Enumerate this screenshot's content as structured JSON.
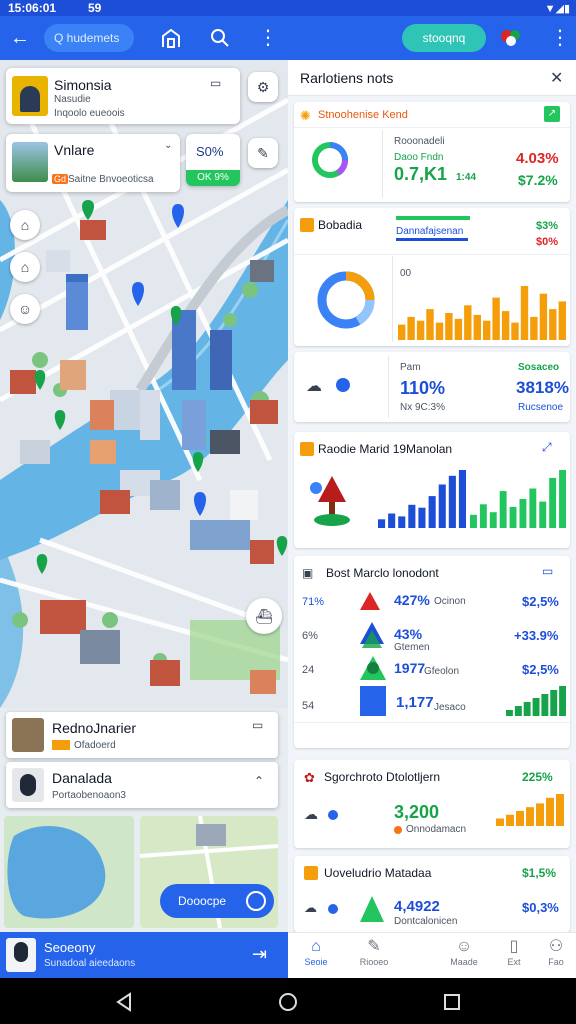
{
  "status": {
    "time": "15:06:01",
    "extra": "59",
    "signal": "▼◢▮"
  },
  "left_appbar": {
    "search_label": "Q hudemets"
  },
  "right_appbar": {
    "pill_label": "stooqnq"
  },
  "map_cards": {
    "top": {
      "title": "Simonsia",
      "subtitle": "Nasudie",
      "line3": "Inqoolo eueoois"
    },
    "second": {
      "title": "Vnlare",
      "badge": "Gd",
      "subtitle": "Saitne Bnvoeoticsa",
      "value": "S0%",
      "tag": "OK 9%"
    }
  },
  "bottom_list": {
    "item1": {
      "title": "RednoJnarier",
      "subtitle": "Ofadoerd"
    },
    "item2": {
      "title": "Danalada",
      "subtitle": "Portaobenoaon3"
    },
    "button": "Dooocpe"
  },
  "bottom_bar": {
    "title": "Seoeony",
    "subtitle": "Sunadoal aieedaons"
  },
  "panel": {
    "title": "Rarlotiens nots",
    "card1": {
      "title": "Stnoohenise Kend",
      "label": "Rooonadeli",
      "sub": "Daoo Fndn",
      "big": "0.7,K1",
      "tail": "1:44",
      "pct_red": "4.03%",
      "pct_green": "$7.2%"
    },
    "card2": {
      "title": "Bobadia",
      "bar_label": "Dannafajsenan",
      "v1": "$3%",
      "v2": "$0%",
      "axis": "00",
      "bars": [
        8,
        12,
        10,
        16,
        9,
        14,
        11,
        18,
        13,
        10,
        22,
        15,
        9,
        28,
        12,
        24,
        16,
        20
      ]
    },
    "card3": {
      "label": "Pam",
      "big": "110%",
      "sub": "Nx 9C:3%",
      "right_label": "Sosaceo",
      "right_big": "3818%",
      "right_sub": "Rucsenoe"
    },
    "card4": {
      "title": "Raodie Marid 19Manolan",
      "blue_bars": [
        6,
        10,
        8,
        16,
        14,
        22,
        30,
        36,
        40
      ],
      "green_bars": [
        10,
        18,
        12,
        28,
        16,
        22,
        30,
        20,
        38,
        44
      ]
    },
    "card5": {
      "title": "Bost Marclo lonodont",
      "rows": [
        {
          "left": "71%",
          "mid": "427%",
          "sub": "Ocinon",
          "right": "$2,5%"
        },
        {
          "left": "6%",
          "mid": "43%",
          "sub": "Gtemen",
          "right": "+33.9%"
        },
        {
          "left": "24",
          "mid": "1977",
          "sub": "Gfeolon",
          "right": "$2,5%"
        },
        {
          "left": "54",
          "mid": "1,177",
          "sub": "Jesaco",
          "right": ""
        }
      ]
    },
    "card6": {
      "title": "Sgorchroto Dtolotljern",
      "big": "3,200",
      "sub": "Onnodamacn",
      "right": "225%"
    },
    "card7": {
      "title": "Uoveludrio Matadaa",
      "big": "4,4922",
      "sub": "Dontcalonicen",
      "right1": "$1,5%",
      "right2": "$0,3%"
    }
  },
  "tabs": [
    "Seoie",
    "Riooeo",
    "Maade",
    "Ext",
    "Fao"
  ]
}
